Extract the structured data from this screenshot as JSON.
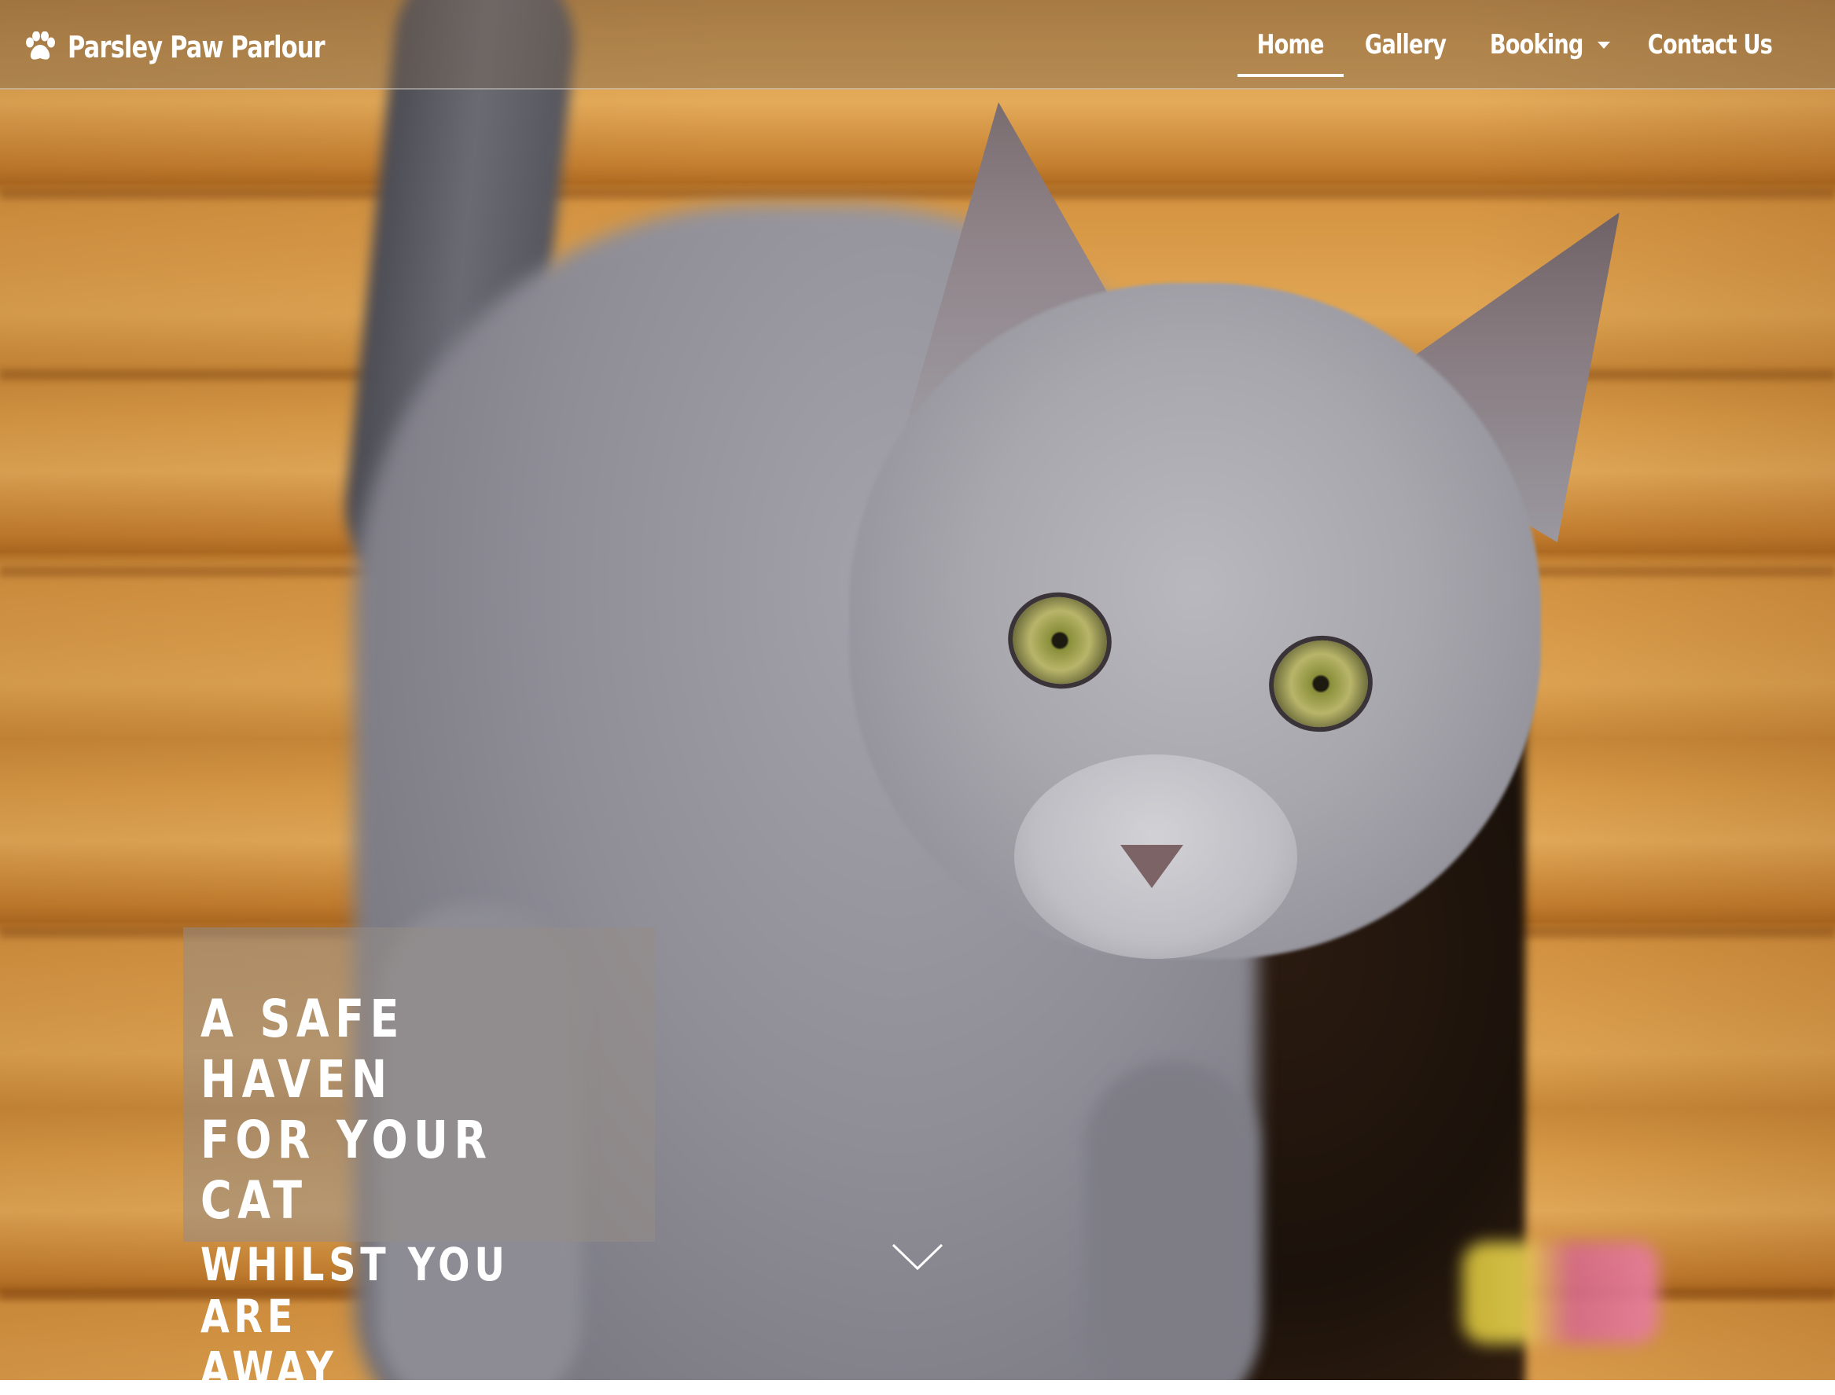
{
  "brand": {
    "name": "Parsley Paw Parlour",
    "icon": "paw-icon"
  },
  "nav": {
    "items": [
      {
        "label": "Home",
        "active": true
      },
      {
        "label": "Gallery",
        "active": false
      },
      {
        "label": "Booking",
        "active": false,
        "has_dropdown": true
      },
      {
        "label": "Contact Us",
        "active": false
      }
    ]
  },
  "hero": {
    "image": "grey cat standing in front of a wooden cat house",
    "tagline_main": "A SAFE HAVEN\nFOR YOUR CAT",
    "tagline_sub": "WHILST YOU ARE\nAWAY",
    "scroll_icon": "chevron-down-icon"
  },
  "colors": {
    "nav_text": "#ffffff",
    "nav_bg": "rgba(120,100,80,0.42)",
    "tagline_bg": "rgba(150,140,135,0.55)"
  }
}
